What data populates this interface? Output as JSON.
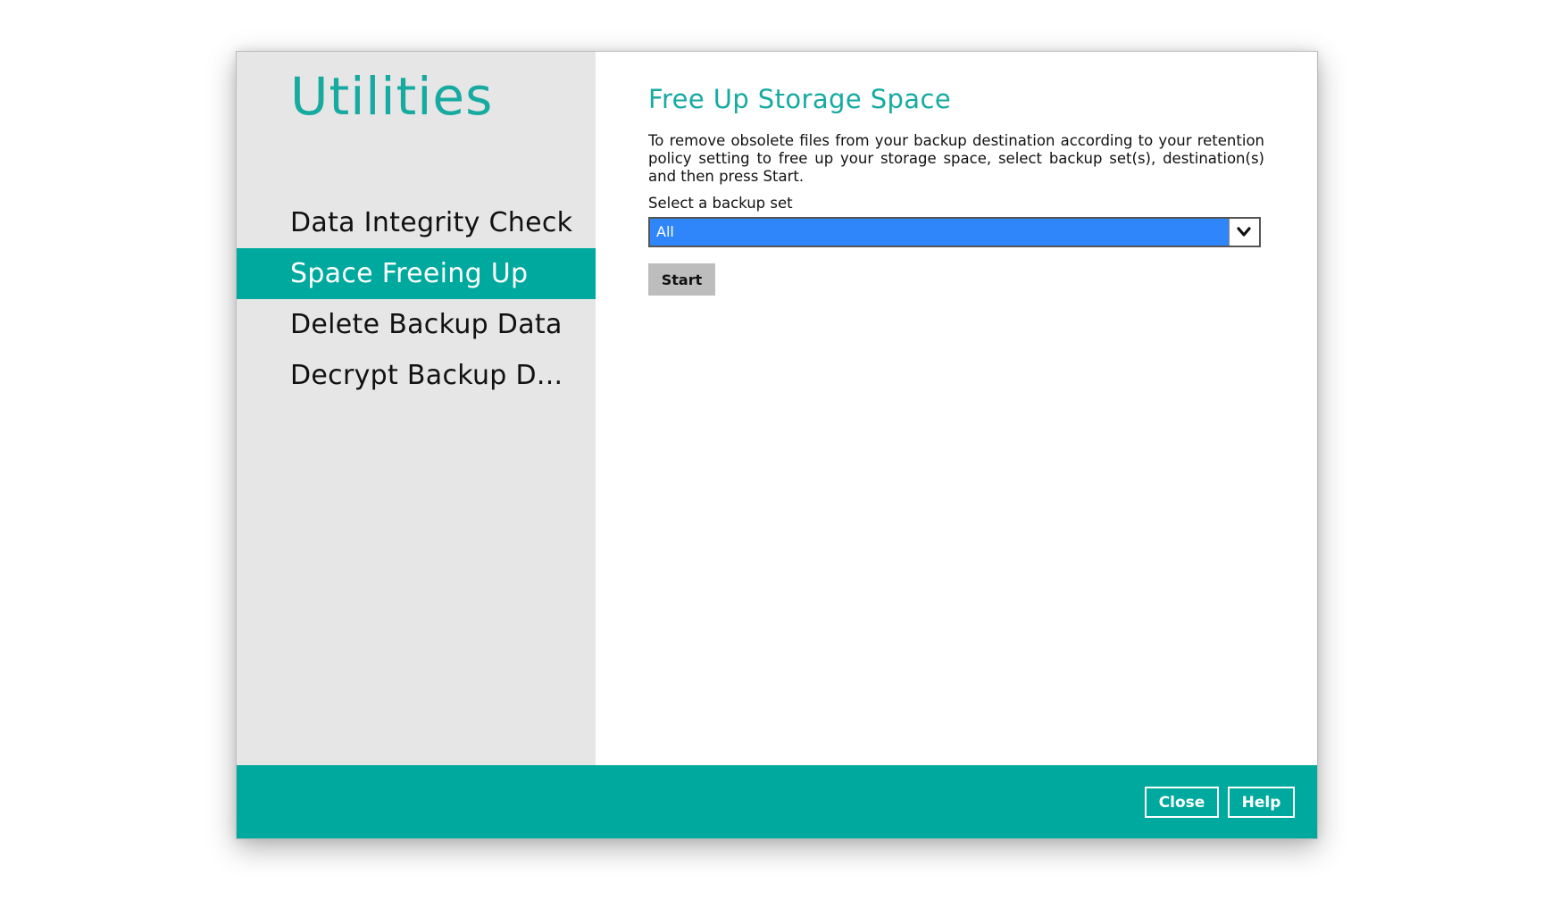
{
  "sidebar": {
    "title": "Utilities",
    "items": [
      {
        "label": "Data Integrity Check",
        "active": false
      },
      {
        "label": "Space Freeing Up",
        "active": true
      },
      {
        "label": "Delete Backup Data",
        "active": false
      },
      {
        "label": "Decrypt Backup D...",
        "active": false
      }
    ]
  },
  "main": {
    "title": "Free Up Storage Space",
    "description": "To remove obsolete files from your backup destination according to your retention policy setting to free up your storage space, select backup set(s), destination(s) and then press Start.",
    "select_label": "Select a backup set",
    "select_value": "All",
    "start_label": "Start"
  },
  "footer": {
    "close_label": "Close",
    "help_label": "Help"
  },
  "colors": {
    "accent": "#00a99d",
    "title_teal": "#16aaa0",
    "select_highlight": "#2f86fb",
    "sidebar_bg": "#e6e6e6",
    "start_button_bg": "#bdbdbd"
  },
  "icons": {
    "dropdown": "chevron-down-icon"
  }
}
